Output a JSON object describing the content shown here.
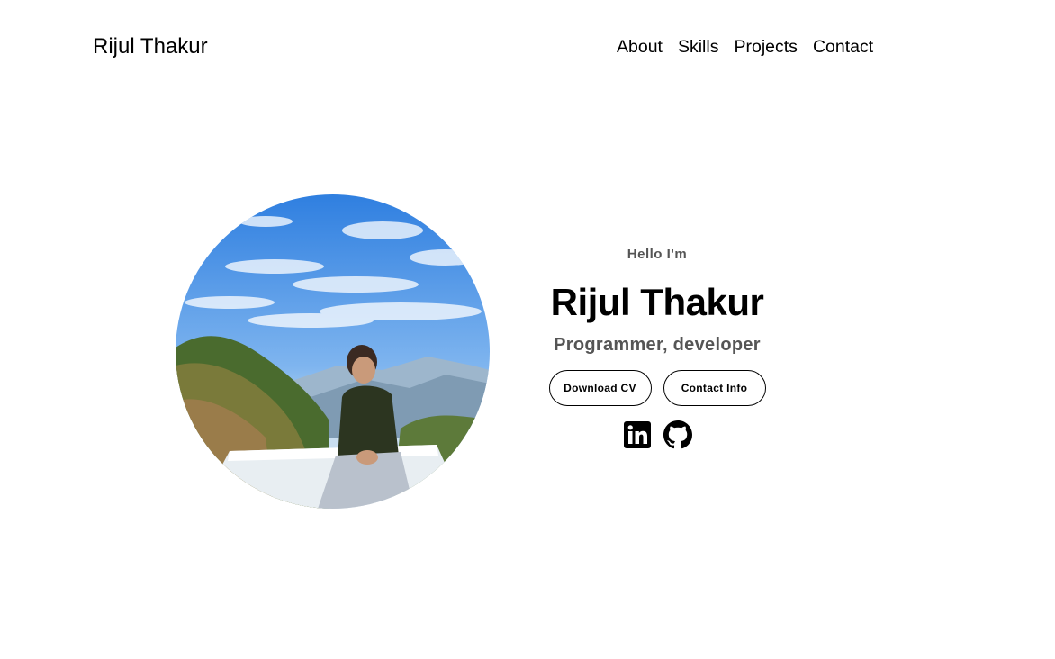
{
  "nav": {
    "logo": "Rijul Thakur",
    "links": [
      "About",
      "Skills",
      "Projects",
      "Contact"
    ]
  },
  "hero": {
    "greeting": "Hello I'm",
    "name": "Rijul Thakur",
    "role": "Programmer, developer",
    "buttons": {
      "download_cv": "Download CV",
      "contact_info": "Contact Info"
    },
    "socials": [
      "linkedin-icon",
      "github-icon"
    ]
  }
}
